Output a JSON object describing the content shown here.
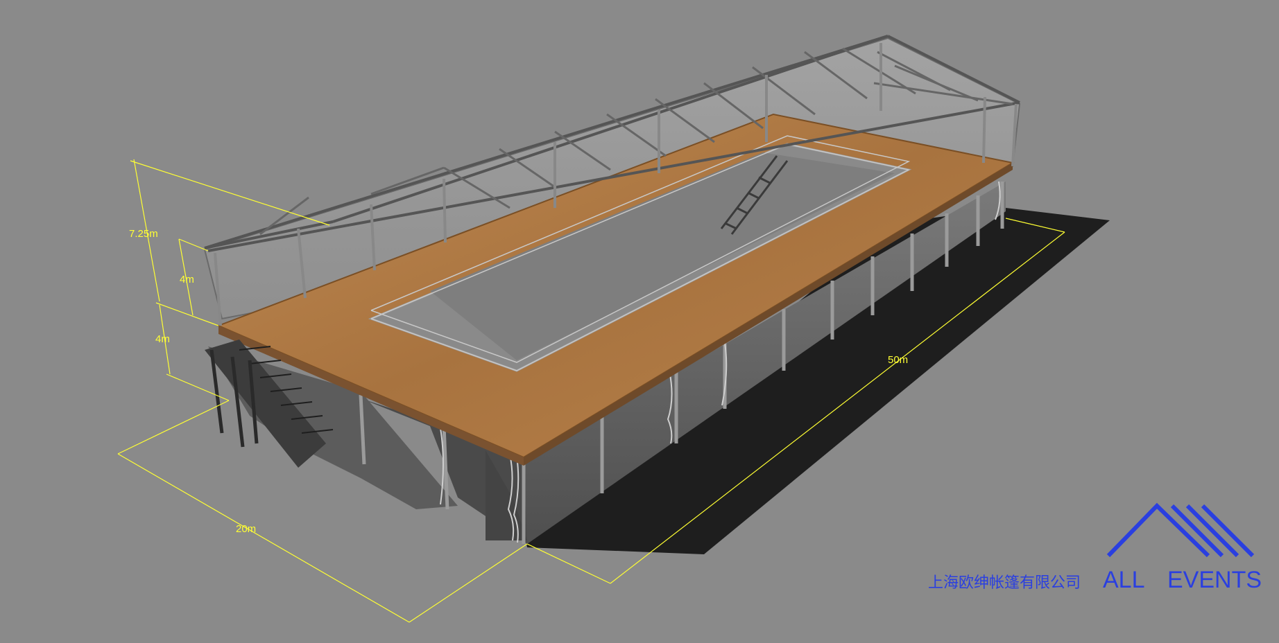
{
  "dimensions": {
    "total_height": "7.25m",
    "upper_height": "4m",
    "lower_height": "4m",
    "width": "20m",
    "length": "50m"
  },
  "branding": {
    "company_cn": "上海欧绅帐篷有限公司",
    "brand_word_1": "ALL",
    "brand_word_2": "EVENTS",
    "brand_color": "#2a3fe0"
  },
  "colors": {
    "background": "#8a8a8a",
    "dimension_lines": "#ffff33",
    "deck": "#b07a44",
    "shadow": "#1e1e1e",
    "frame": "#5a5a5a"
  }
}
